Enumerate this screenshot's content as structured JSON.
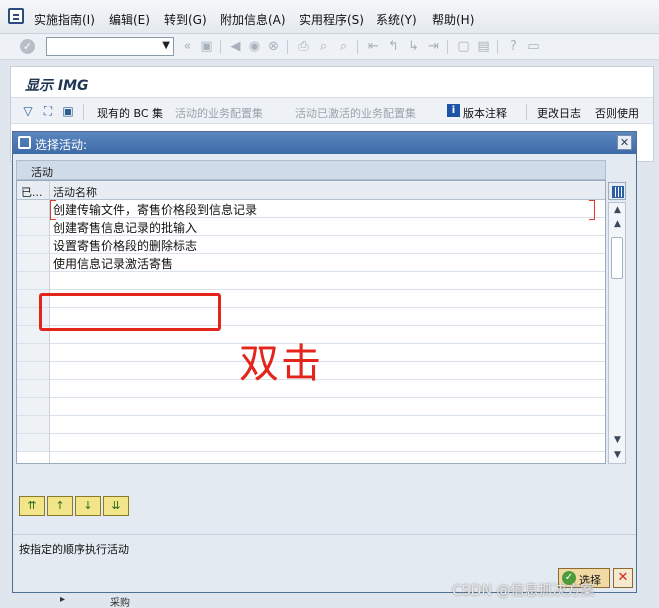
{
  "menu": {
    "items": [
      "实施指南(I)",
      "编辑(E)",
      "转到(G)",
      "附加信息(A)",
      "实用程序(S)",
      "系统(Y)",
      "帮助(H)"
    ]
  },
  "toolbar": {
    "command_field_value": ""
  },
  "img": {
    "title": "显示 IMG",
    "tools": {
      "bc_set": "现有的 BC 集",
      "activity_bc_sets": "活动的业务配置集",
      "activity_activated_bc_sets": "活动已激活的业务配置集",
      "release_notes": "版本注释",
      "change_log": "更改日志",
      "no_use": "否则使用"
    }
  },
  "dialog": {
    "title": "选择活动:",
    "group_label": "活动",
    "table": {
      "columns": [
        "已...",
        "活动名称"
      ],
      "rows": [
        "创建传输文件，寄售价格段到信息记录",
        "创建寄售信息记录的批输入",
        "设置寄售价格段的删除标志",
        "使用信息记录激活寄售"
      ],
      "empty_rows": 10
    },
    "status_text": "按指定的顺序执行活动",
    "confirm_label": "选择",
    "cancel_label": "✕"
  },
  "annotation": {
    "text": "双击",
    "color": "#e3251c"
  },
  "background_tree": {
    "label": "采购"
  },
  "watermark": "CSDN @信息抓决方案",
  "colors": {
    "title_bar": "#3e6ba7",
    "accent": "#2c5c94"
  }
}
